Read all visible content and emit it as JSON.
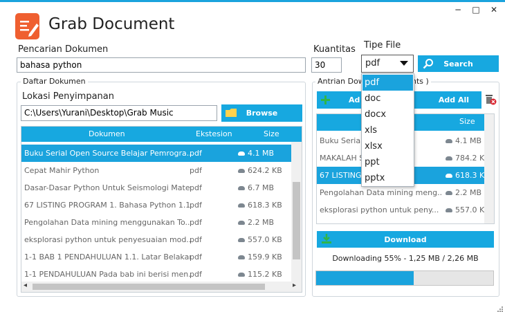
{
  "app": {
    "title": "Grab Document",
    "window_controls": {
      "minimize": "−",
      "maximize": "□",
      "close": "✕"
    },
    "accent": "#17a8e0",
    "logo_color": "#ef5f30"
  },
  "search": {
    "label": "Pencarian Dokumen",
    "value": "bahasa python",
    "quantity_label": "Kuantitas",
    "quantity_value": "30",
    "filetype_label": "Tipe File",
    "filetype_value": "pdf",
    "button_label": "Search",
    "filetype_options": [
      "pdf",
      "doc",
      "docx",
      "xls",
      "xlsx",
      "ppt",
      "pptx"
    ]
  },
  "daftar": {
    "group_label": "Daftar Dokumen",
    "lokasi_label": "Lokasi Penyimpanan",
    "path_value": "C:\\Users\\Yurani\\Desktop\\Grab Music",
    "browse_label": "Browse",
    "columns": [
      "Dokumen",
      "Ekstesion",
      "Size"
    ],
    "rows": [
      {
        "doc": "Buku Serial Open Source Belajar Pemrogra...",
        "ext": "pdf",
        "size": "4.1 MB",
        "selected": true
      },
      {
        "doc": "Cepat Mahir Python",
        "ext": "pdf",
        "size": "624.2 KB",
        "selected": false
      },
      {
        "doc": "Dasar-Dasar Python Untuk Seismologi Mate...",
        "ext": "pdf",
        "size": "6.7 MB",
        "selected": false
      },
      {
        "doc": "67 LISTING PROGRAM 1. Bahasa Python 1.1 ...",
        "ext": "pdf",
        "size": "618.3 KB",
        "selected": false
      },
      {
        "doc": "Pengolahan Data mining menggunakan To...",
        "ext": "pdf",
        "size": "2.2 MB",
        "selected": false
      },
      {
        "doc": "eksplorasi python untuk penyesuaian mod...",
        "ext": "pdf",
        "size": "557.0 KB",
        "selected": false
      },
      {
        "doc": "1-1 BAB 1 PENDAHULUAN 1.1. Latar Belakan...",
        "ext": "pdf",
        "size": "159.9 KB",
        "selected": false
      },
      {
        "doc": "1-1 PENDAHULUAN Pada bab ini berisi men...",
        "ext": "pdf",
        "size": "115.2 KB",
        "selected": false
      }
    ],
    "scroll_left": "◂",
    "scroll_right": "▸"
  },
  "antrian": {
    "group_label_start": "Antrian Down",
    "group_label_end": "nts )",
    "add_label": "Ad",
    "add_all_label": "Add All",
    "size_header": "Size",
    "rows": [
      {
        "doc": "Buku Serial O",
        "size": "4.1 MB",
        "selected": false
      },
      {
        "doc": "MAKALAH S",
        "size": "784.2 KB",
        "selected": false
      },
      {
        "doc": "67 LISTING P",
        "size": "618.3 KB",
        "selected": true
      },
      {
        "doc": "Pengolahan Data mining meng...",
        "size": "2.2 MB",
        "selected": false
      },
      {
        "doc": "eksplorasi python untuk peny...",
        "size": "557.0 KB",
        "selected": false
      }
    ],
    "download_label": "Download",
    "status": "Downloading 55%  -  1,25 MB / 2,26 MB",
    "progress": 0.55
  }
}
